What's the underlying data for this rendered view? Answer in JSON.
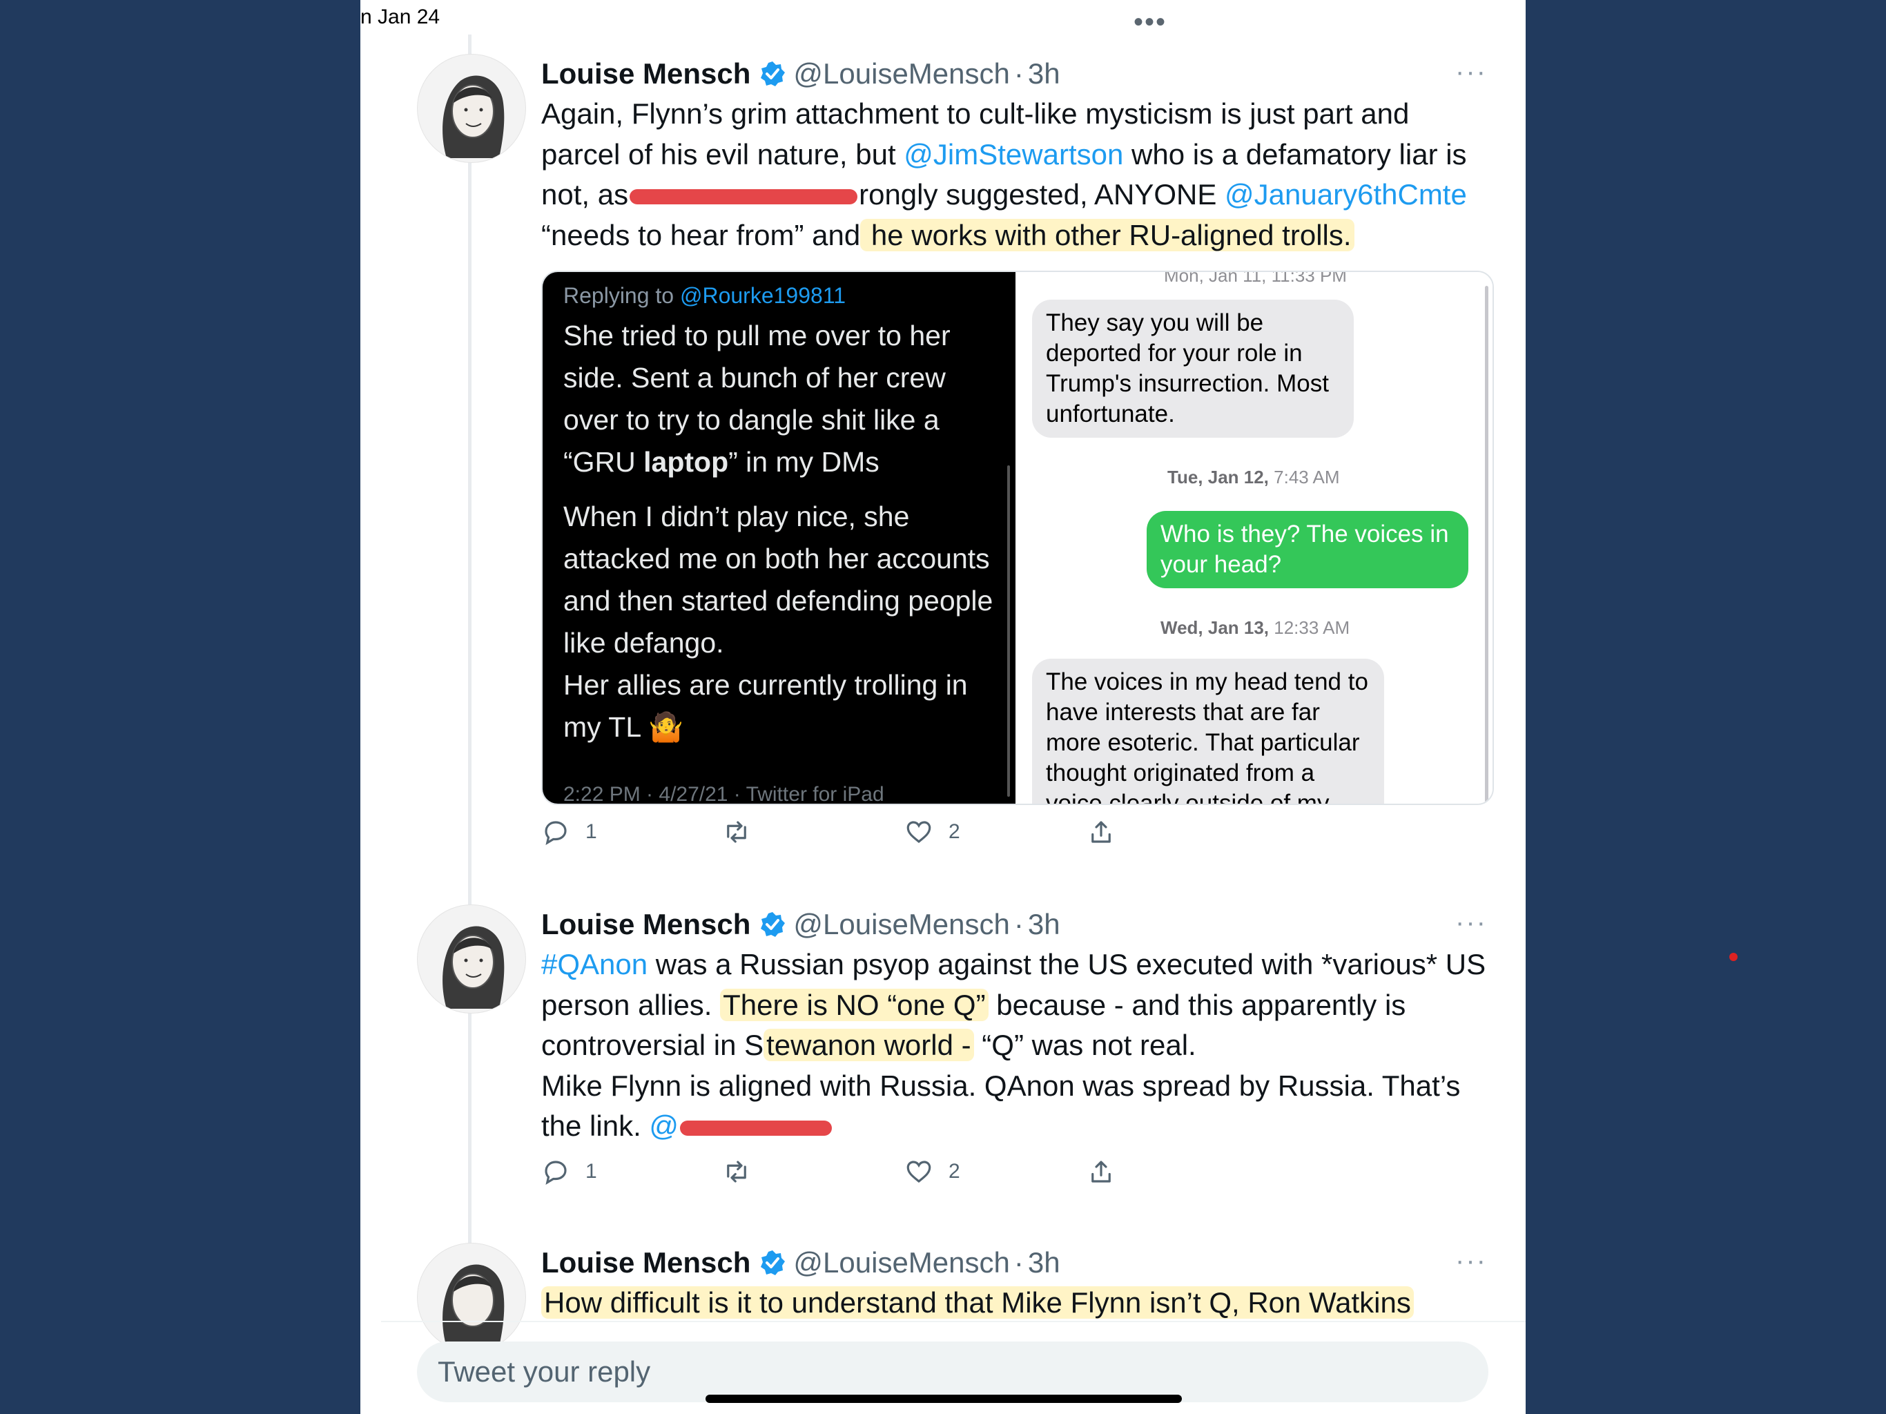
{
  "status": {
    "date_fragment": "n Jan 24",
    "more": "•••"
  },
  "colors": {
    "link": "#1d9bf0",
    "highlight": "#fff4c6",
    "redaction": "#e3363a",
    "imessage_green": "#34c759",
    "page_bg": "#1e3557"
  },
  "tweets": [
    {
      "name": "Louise Mensch",
      "handle": "@LouiseMensch",
      "sep": "·",
      "time": "3h",
      "more": "···",
      "t1": "Again, Flynn’s grim attachment to cult-like mysticism is just part and parcel of his evil nature, but ",
      "link1": "@JimStewartson",
      "t2": " who is a defamatory liar is not, as",
      "t3": "rongly suggested, ANYONE ",
      "link2": "@January6thCmte",
      "t4": " “needs to hear from” and",
      "t5": " he works with other RU-aligned trolls.",
      "actions": {
        "reply_count": "1",
        "like_count": "2"
      }
    },
    {
      "name": "Louise Mensch",
      "handle": "@LouiseMensch",
      "sep": "·",
      "time": "3h",
      "more": "···",
      "link1": "#QAnon",
      "t1": " was a Russian psyop against the US executed with *various* US person allies. ",
      "t2": "There is NO “one Q”",
      "t3": " because - and this apparently is controversial in S",
      "t4": "tewanon world -",
      "t5": " “Q” was not real.",
      "t6": "Mike Flynn is aligned with Russia. QAnon was spread by Russia. That’s the link. ",
      "t7": "@",
      "actions": {
        "reply_count": "1",
        "like_count": "2"
      }
    },
    {
      "name": "Louise Mensch",
      "handle": "@LouiseMensch",
      "sep": "·",
      "time": "3h",
      "more": "···",
      "t1": "How difficult is it to understand that Mike Flynn isn’t Q, Ron Watkins"
    }
  ],
  "media": {
    "left": {
      "reply_prefix": "Replying to ",
      "reply_handle": "@Rourke199811",
      "p1a": "She tried to pull me over to her side. Sent a bunch of her crew over to try to dangle shit like a “GRU ",
      "p1b": "laptop",
      "p1c": "” in my DMs",
      "p2": "When I didn’t play nice, she attacked me on both her accounts and then started defending people like defango.",
      "p3": "Her allies are currently trolling in my TL 🤷",
      "footer": "2:22 PM · 4/27/21 · Twitter for iPad"
    },
    "right": {
      "cut_stamp": "Mon, Jan 11, 11:33 PM",
      "b1": "They say you will be deported for your role in Trump's insurrection. Most unfortunate.",
      "s1_day": "Tue, Jan 12,",
      "s1_time": " 7:43 AM",
      "b2": "Who is they? The voices in your head?",
      "s2_day": "Wed, Jan 13,",
      "s2_time": " 12:33 AM",
      "b3": "The voices in my head tend to have interests that are far more esoteric. That particular thought originated from a voice clearly outside of my"
    }
  },
  "reply": {
    "placeholder": "Tweet your reply"
  },
  "icons": [
    "verified-badge-icon",
    "reply-icon",
    "retweet-icon",
    "like-icon",
    "share-icon",
    "more-icon"
  ]
}
